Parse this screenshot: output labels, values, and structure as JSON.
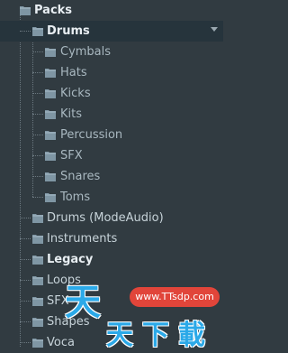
{
  "browser": {
    "root": {
      "label": "Packs",
      "icon": "folder-icon"
    },
    "drums": {
      "label": "Drums",
      "icon": "folder-icon"
    },
    "drum_children": [
      {
        "label": "Cymbals"
      },
      {
        "label": "Hats"
      },
      {
        "label": "Kicks"
      },
      {
        "label": "Kits"
      },
      {
        "label": "Percussion"
      },
      {
        "label": "SFX"
      },
      {
        "label": "Snares"
      },
      {
        "label": "Toms"
      }
    ],
    "packs_children": [
      {
        "label": "Drums (ModeAudio)"
      },
      {
        "label": "Instruments"
      },
      {
        "label": "Legacy"
      },
      {
        "label": "Loops"
      },
      {
        "label": "SFX"
      },
      {
        "label": "Shapes"
      },
      {
        "label": "Voca"
      }
    ]
  },
  "watermark": {
    "text": "www.TTsdp.com",
    "chars": [
      "天",
      "天",
      "下",
      "載"
    ],
    "color": "#2ba9e8",
    "pill_color": "#e1453a"
  },
  "colors": {
    "background": "#313b41",
    "selected_row": "#26343c",
    "folder": "#7f96a4"
  }
}
